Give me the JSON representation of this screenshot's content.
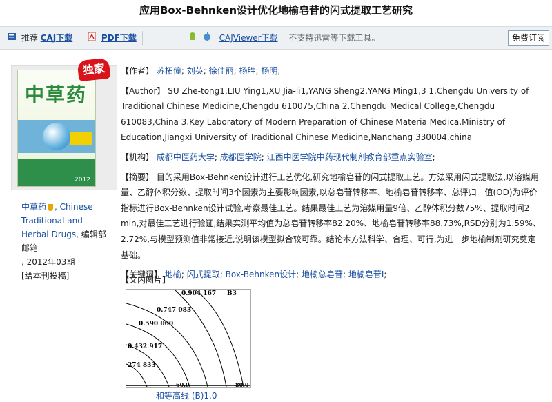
{
  "page": {
    "title": "应用Box-Behnken设计优化地榆皂苷的闪式提取工艺研究"
  },
  "toolbar": {
    "recommend_label": "推荐",
    "caj_download": "CAJ下载",
    "pdf_download": "PDF下载",
    "cajviewer_download": "CAJViewer下载",
    "notice": "不支持迅雷等下载工具。",
    "free_subscribe": "免费订阅"
  },
  "sidebar": {
    "exclusive_badge": "独家",
    "cover": {
      "title": "中草药",
      "year": "2012"
    },
    "journal_name": "中草药",
    "journal_en": ", Chinese Traditional and Herbal Drugs",
    "publisher": ", 编辑部邮箱",
    "issue": ", 2012年03期",
    "submit": "[给本刊投稿]"
  },
  "article": {
    "author_label": "【作者】",
    "authors": [
      "苏柘僮",
      "刘英",
      "徐佳丽",
      "杨胜",
      "杨明"
    ],
    "author_en_label": "【Author】",
    "author_en": "SU Zhe-tong1,LIU Ying1,XU Jia-li1,YANG Sheng2,YANG Ming1,3 1.Chengdu University of Traditional Chinese Medicine,Chengdu 610075,China 2.Chengdu Medical College,Chengdu 610083,China 3.Key Laboratory of Modern Preparation of Chinese Materia Medica,Ministry of Education,Jiangxi University of Traditional Chinese Medicine,Nanchang 330004,china",
    "org_label": "【机构】",
    "orgs": [
      "成都中医药大学",
      "成都医学院",
      "江西中医学院中药现代制剂教育部重点实验室"
    ],
    "abstract_label": "【摘要】",
    "abstract": "目的采用Box-Behnken设计进行工艺优化,研究地榆皂苷的闪式提取工艺。方法采用闪式提取法,以溶媒用量、乙醇体积分数、提取时间3个因素为主要影响因素,以总皂苷转移率、地榆皂苷转移率、总评归一值(OD)为评价指标进行Box-Behnken设计试验,考察最佳工艺。结果最佳工艺为溶媒用量9倍、乙醇体积分数75%、提取时间2 min,对最佳工艺进行验证,结果实测平均值为总皂苷转移率82.20%、地榆皂苷转移率88.73%,RSD分别为1.59%、2.72%,与模型预测值非常接近,说明该模型拟合较可靠。结论本方法科学、合理、可行,为进一步地榆制剂研究奠定基础。",
    "keywords_label": "【关键词】",
    "keywords": [
      "地榆",
      "闪式提取",
      "Box-Behnken设计",
      "地榆总皂苷",
      "地榆皂苷Ⅰ"
    ],
    "figure_label": "【文内图片】",
    "figure": {
      "contour_labels": [
        "0.904 167",
        "0.747 083",
        "0.590 000",
        "0.432 917",
        "274 833"
      ],
      "corner_label": "B3",
      "axis_ticks": [
        "60.0",
        "80.0"
      ],
      "caption": "和等高线 (B)1.0"
    }
  },
  "colors": {
    "link": "#1a4fa0",
    "toolbar_bg": "#eef1f4",
    "badge": "#d8141a"
  }
}
